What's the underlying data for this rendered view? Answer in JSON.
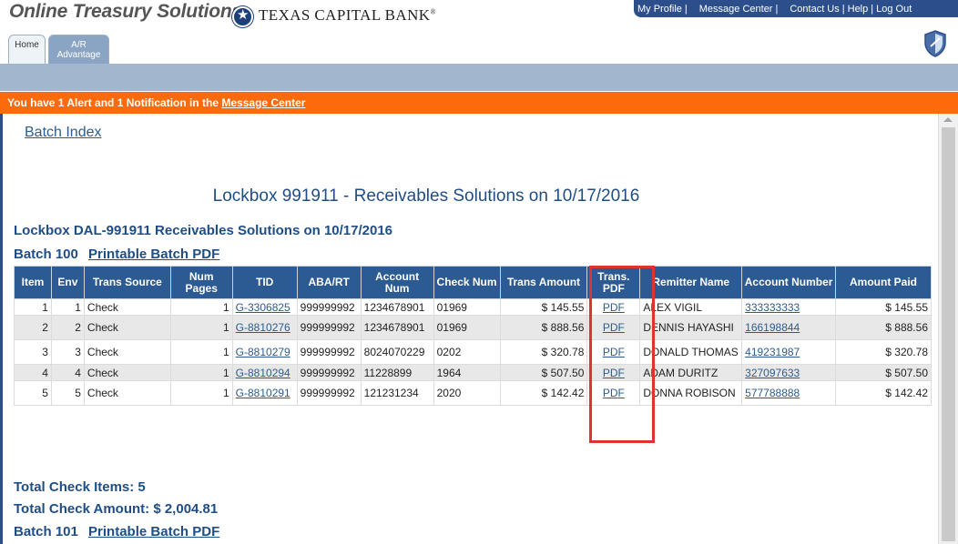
{
  "header": {
    "brand": "Online Treasury Solutions",
    "bank_name": "TEXAS CAPITAL BANK",
    "bank_mark": "®",
    "nav": [
      "My Profile",
      "Message Center",
      "Contact Us",
      "Help",
      "Log Out"
    ],
    "tabs": [
      "Home",
      "A/R Advantage"
    ]
  },
  "alert": {
    "prefix": "You have 1 Alert and 1 Notification in the ",
    "link": "Message Center"
  },
  "main": {
    "batch_index": "Batch Index",
    "page_title": "Lockbox 991911 - Receivables Solutions on 10/17/2016",
    "sub_title": "Lockbox DAL-991911 Receivables Solutions on 10/17/2016",
    "batch_100_label": "Batch 100",
    "batch_101_label": "Batch 101",
    "printable_pdf": "Printable Batch PDF",
    "total_items": "Total Check Items: 5",
    "total_amount": "Total Check Amount: $ 2,004.81"
  },
  "table": {
    "columns": [
      "Item",
      "Env",
      "Trans Source",
      "Num Pages",
      "TID",
      "ABA/RT",
      "Account Num",
      "Check Num",
      "Trans Amount",
      "Trans. PDF",
      "Remitter Name",
      "Account Number",
      "Amount Paid"
    ],
    "rows": [
      [
        "1",
        "1",
        "Check",
        "1",
        "G-3306825",
        "999999992",
        "1234678901",
        "01969",
        "$ 145.55",
        "PDF",
        "ALEX VIGIL",
        "333333333",
        "$ 145.55"
      ],
      [
        "2",
        "2",
        "Check",
        "1",
        "G-8810276",
        "999999992",
        "1234678901",
        "01969",
        "$ 888.56",
        "PDF",
        "DENNIS HAYASHI",
        "166198844",
        "$ 888.56"
      ],
      [
        "3",
        "3",
        "Check",
        "1",
        "G-8810279",
        "999999992",
        "8024070229",
        "0202",
        "$ 320.78",
        "PDF",
        "DONALD THOMAS",
        "419231987",
        "$ 320.78"
      ],
      [
        "4",
        "4",
        "Check",
        "1",
        "G-8810294",
        "999999992",
        "11228899",
        "1964",
        "$ 507.50",
        "PDF",
        "ADAM DURITZ",
        "327097633",
        "$ 507.50"
      ],
      [
        "5",
        "5",
        "Check",
        "1",
        "G-8810291",
        "999999992",
        "121231234",
        "2020",
        "$ 142.42",
        "PDF",
        "DONNA ROBISON",
        "577788888",
        "$ 142.42"
      ]
    ]
  },
  "colors": {
    "nav_blue": "#2c4f8c",
    "header_blue": "#2c5a92",
    "alert_orange": "#fc6a0c",
    "highlight_red": "#dd3333"
  },
  "icons": {
    "bank_logo": "star-seal-icon",
    "security": "shield-icon"
  }
}
